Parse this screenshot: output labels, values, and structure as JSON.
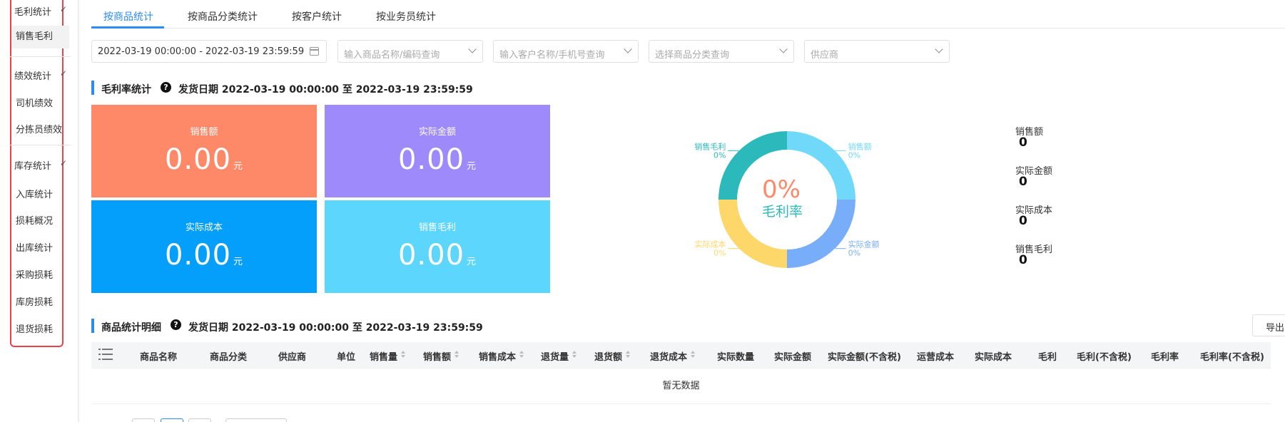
{
  "sidebar": {
    "groups": [
      {
        "label": "毛利统计",
        "items": [
          "销售毛利"
        ]
      },
      {
        "label": "绩效统计",
        "items": [
          "司机绩效",
          "分拣员绩效"
        ]
      },
      {
        "label": "库存统计",
        "items": [
          "入库统计",
          "损耗概况",
          "出库统计",
          "采购损耗",
          "库房损耗",
          "退货损耗"
        ]
      }
    ]
  },
  "tabs": [
    "按商品统计",
    "按商品分类统计",
    "按客户统计",
    "按业务员统计"
  ],
  "filters": {
    "date_range": "2022-03-19 00:00:00 - 2022-03-19 23:59:59",
    "product_placeholder": "输入商品名称/编码查询",
    "customer_placeholder": "输入客户名称/手机号查询",
    "category_placeholder": "选择商品分类查询",
    "supplier_placeholder": "供应商"
  },
  "margin_section": {
    "title": "毛利率统计",
    "date": "发货日期 2022-03-19 00:00:00 至 2022-03-19 23:59:59"
  },
  "cards": [
    {
      "label": "销售额",
      "value": "0.00",
      "unit": "元",
      "color": "#fe8969"
    },
    {
      "label": "实际金额",
      "value": "0.00",
      "unit": "元",
      "color": "#9e8afa"
    },
    {
      "label": "实际成本",
      "value": "0.00",
      "unit": "元",
      "color": "#039ffb"
    },
    {
      "label": "销售毛利",
      "value": "0.00",
      "unit": "元",
      "color": "#5cd6fd"
    }
  ],
  "donut": {
    "center_value": "0%",
    "center_label": "毛利率",
    "segments": [
      {
        "name": "销售额",
        "percent": "0%",
        "color": "#70d9f9",
        "share": 0.25
      },
      {
        "name": "实际金额",
        "percent": "0%",
        "color": "#78adf9",
        "share": 0.25
      },
      {
        "name": "实际成本",
        "percent": "0%",
        "color": "#fdd769",
        "share": 0.25
      },
      {
        "name": "销售毛利",
        "percent": "0%",
        "color": "#2bb9bb",
        "share": 0.25
      }
    ]
  },
  "summary": [
    {
      "label": "销售额",
      "value": "0"
    },
    {
      "label": "实际金额",
      "value": "0"
    },
    {
      "label": "实际成本",
      "value": "0"
    },
    {
      "label": "销售毛利",
      "value": "0"
    }
  ],
  "detail_section": {
    "title": "商品统计明细",
    "date": "发货日期 2022-03-19 00:00:00 至 2022-03-19 23:59:59",
    "export_label": "导出"
  },
  "table": {
    "columns": [
      "商品名称",
      "商品分类",
      "供应商",
      "单位",
      "销售量",
      "销售额",
      "销售成本",
      "退货量",
      "退货额",
      "退货成本",
      "实际数量",
      "实际金额",
      "实际金额(不含税)",
      "运营成本",
      "实际成本",
      "毛利",
      "毛利(不含税)",
      "毛利率",
      "毛利率(不含税)"
    ],
    "empty_text": "暂无数据"
  }
}
